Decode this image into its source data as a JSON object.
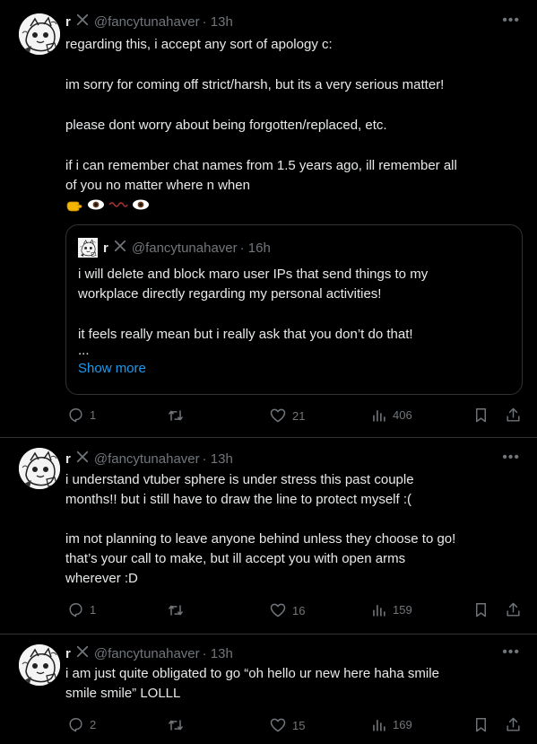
{
  "tweets": [
    {
      "name": "r",
      "handle": "@fancytunahaver",
      "time": "· 13h",
      "lines": [
        "regarding this, i accept any sort of apology c:",
        "",
        "im sorry for coming off strict/harsh, but its a very serious matter!",
        "",
        "please dont worry about being forgotten/replaced, etc.",
        "",
        "if i can remember chat names from 1.5 years ago, ill remember all",
        "of you no matter where n when"
      ],
      "emoji": [
        "pointing-hand-icon",
        "eye-icon",
        "wavy-mouth-icon",
        "eye-icon"
      ],
      "quote": {
        "name": "r",
        "handle": "@fancytunahaver",
        "time": "· 16h",
        "lines": [
          "i will delete and block maro user IPs that send things to my",
          "workplace directly regarding my personal activities!",
          "",
          "it feels really mean but i really ask that you don’t do that!",
          "..."
        ],
        "show_more": "Show more"
      },
      "stats": {
        "replies": "1",
        "reposts": "",
        "likes": "21",
        "views": "406"
      }
    },
    {
      "name": "r",
      "handle": "@fancytunahaver",
      "time": "· 13h",
      "lines": [
        "i understand vtuber sphere is under stress this past couple",
        "months!! but i still have to draw the line to protect myself :(",
        "",
        "im not planning to leave anyone behind unless they choose to go!",
        "that’s your call to make, but ill accept you with open arms",
        "wherever :D"
      ],
      "stats": {
        "replies": "1",
        "reposts": "",
        "likes": "16",
        "views": "159"
      }
    },
    {
      "name": "r",
      "handle": "@fancytunahaver",
      "time": "· 13h",
      "lines": [
        "i am just quite obligated to go “oh hello ur new here haha smile",
        "smile smile” LOLLL"
      ],
      "stats": {
        "replies": "2",
        "reposts": "",
        "likes": "15",
        "views": "169"
      }
    }
  ],
  "colors": {
    "background": "#000000",
    "text": "#e7e9ea",
    "muted": "#71767b",
    "link": "#1d9bf0",
    "border": "#2f3336"
  }
}
